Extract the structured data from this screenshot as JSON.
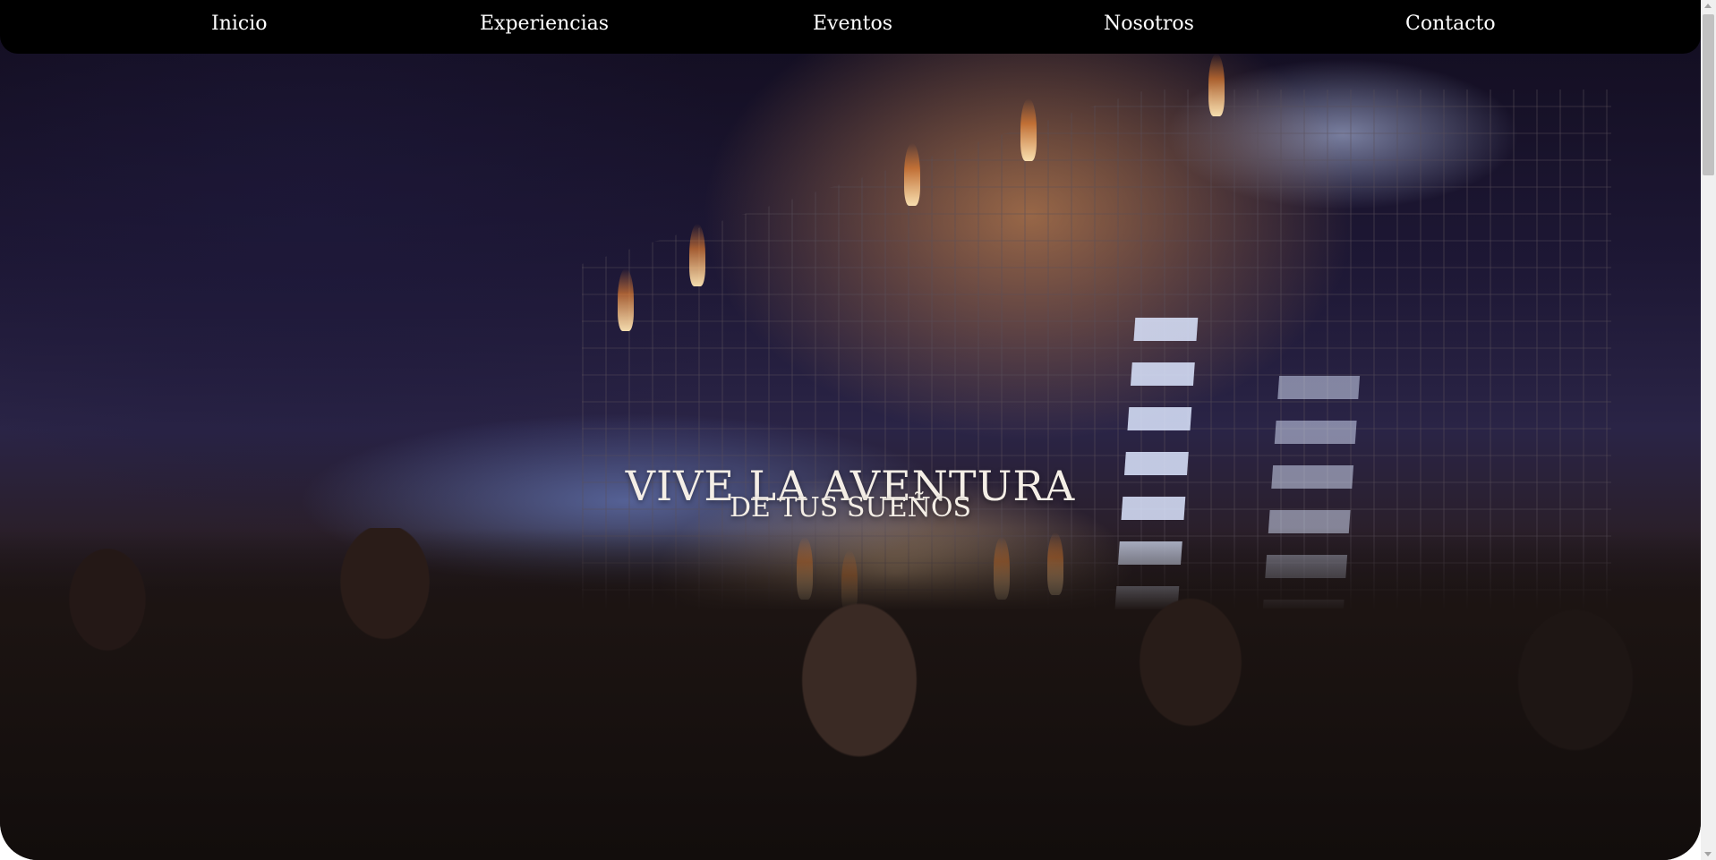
{
  "nav": {
    "items": [
      {
        "label": "Inicio"
      },
      {
        "label": "Experiencias"
      },
      {
        "label": "Eventos"
      },
      {
        "label": "Nosotros"
      },
      {
        "label": "Contacto"
      }
    ]
  },
  "hero": {
    "title": "VIVE LA AVENTURA",
    "subtitle": "DE TUS SUEÑOS"
  }
}
